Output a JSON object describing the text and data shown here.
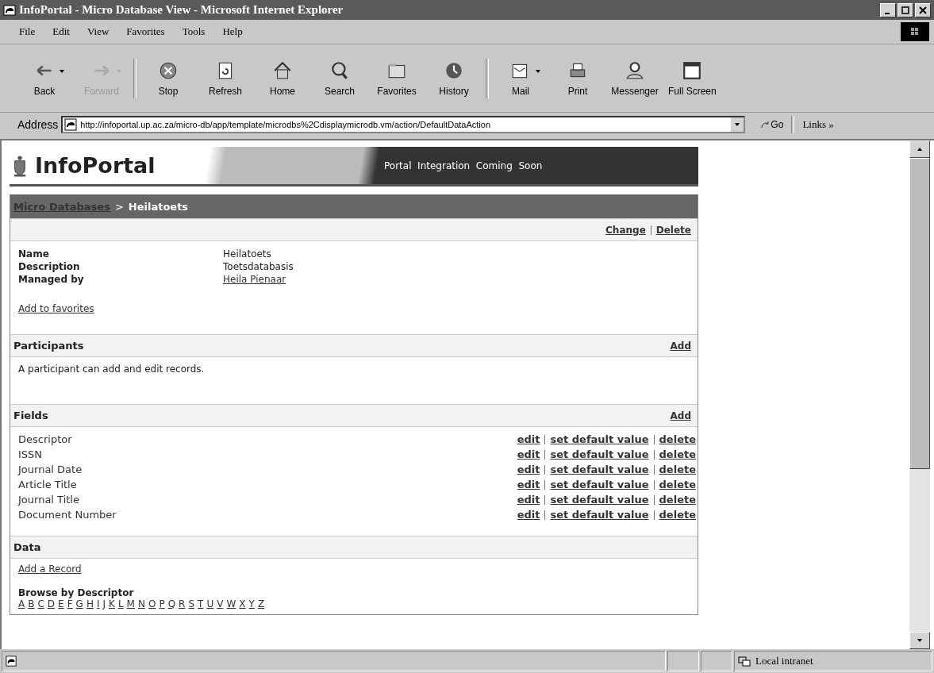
{
  "window": {
    "title": "InfoPortal - Micro Database View - Microsoft Internet Explorer"
  },
  "menu": [
    "File",
    "Edit",
    "View",
    "Favorites",
    "Tools",
    "Help"
  ],
  "toolbar": [
    {
      "label": "Back",
      "disabled": false,
      "dropdown": true
    },
    {
      "label": "Forward",
      "disabled": true,
      "dropdown": true
    },
    {
      "label": "Stop",
      "disabled": false,
      "dropdown": false
    },
    {
      "label": "Refresh",
      "disabled": false,
      "dropdown": false
    },
    {
      "label": "Home",
      "disabled": false,
      "dropdown": false
    },
    {
      "label": "Search",
      "disabled": false,
      "dropdown": false
    },
    {
      "label": "Favorites",
      "disabled": false,
      "dropdown": false
    },
    {
      "label": "History",
      "disabled": false,
      "dropdown": false
    },
    {
      "label": "Mail",
      "disabled": false,
      "dropdown": true
    },
    {
      "label": "Print",
      "disabled": false,
      "dropdown": false
    },
    {
      "label": "Messenger",
      "disabled": false,
      "dropdown": false
    },
    {
      "label": "Full Screen",
      "disabled": false,
      "dropdown": false
    }
  ],
  "address": {
    "label": "Address",
    "value": "http://infoportal.up.ac.za/micro-db/app/template/microdbs%2Cdisplaymicrodb.vm/action/DefaultDataAction",
    "go": "Go",
    "links": "Links »"
  },
  "banner": {
    "logo": "InfoPortal",
    "tagline": "Portal  Integration  Coming  Soon"
  },
  "breadcrumb": {
    "link": "Micro Databases",
    "separator": ">",
    "current": "Heilatoets"
  },
  "actions": [
    "Change",
    "Delete"
  ],
  "details": [
    {
      "label": "Name",
      "value": "Heilatoets",
      "link": false
    },
    {
      "label": "Description",
      "value": "Toetsdatabasis",
      "link": false
    },
    {
      "label": "Managed by",
      "value": "Heila Pienaar",
      "link": true
    }
  ],
  "favorites_link": "Add to favorites",
  "participants": {
    "title": "Participants",
    "add": "Add",
    "text": "A participant can add and edit records."
  },
  "fields": {
    "title": "Fields",
    "add": "Add",
    "items": [
      {
        "name": "Descriptor",
        "actions": [
          "edit",
          "set default value",
          "delete"
        ]
      },
      {
        "name": "ISSN",
        "actions": [
          "edit",
          "set default value",
          "delete"
        ]
      },
      {
        "name": "Journal Date",
        "actions": [
          "edit",
          "set default value",
          "delete"
        ]
      },
      {
        "name": "Article Title",
        "actions": [
          "edit",
          "set default value",
          "delete"
        ]
      },
      {
        "name": "Journal Title",
        "actions": [
          "edit",
          "set default value",
          "delete"
        ]
      },
      {
        "name": "Document Number",
        "actions": [
          "edit",
          "set default value",
          "delete"
        ]
      }
    ]
  },
  "data": {
    "title": "Data",
    "add_record": "Add a Record",
    "browse_title": "Browse by Descriptor",
    "letters": [
      "A",
      "B",
      "C",
      "D",
      "E",
      "F",
      "G",
      "H",
      "I",
      "J",
      "K",
      "L",
      "M",
      "N",
      "O",
      "P",
      "Q",
      "R",
      "S",
      "T",
      "U",
      "V",
      "W",
      "X",
      "Y",
      "Z"
    ]
  },
  "status_bar": {
    "zone": "Local intranet"
  }
}
